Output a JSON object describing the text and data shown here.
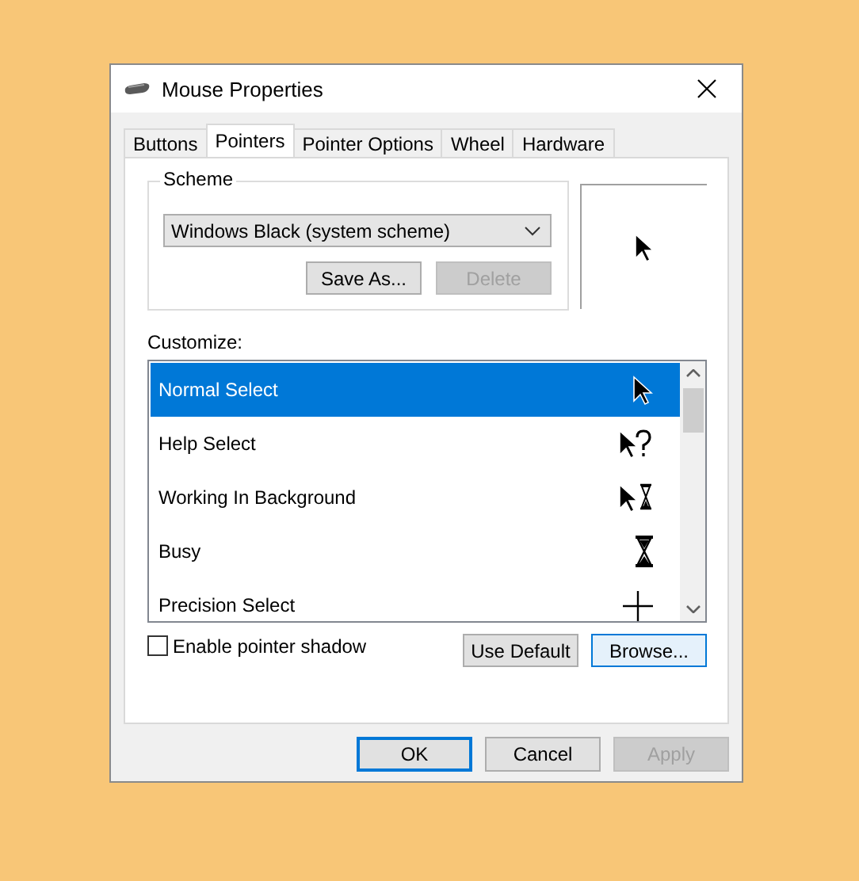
{
  "window": {
    "title": "Mouse Properties"
  },
  "tabs": [
    {
      "label": "Buttons",
      "selected": false
    },
    {
      "label": "Pointers",
      "selected": true
    },
    {
      "label": "Pointer Options",
      "selected": false
    },
    {
      "label": "Wheel",
      "selected": false
    },
    {
      "label": "Hardware",
      "selected": false
    }
  ],
  "scheme": {
    "label": "Scheme",
    "value": "Windows Black (system scheme)",
    "buttons": [
      {
        "label": "Save As...",
        "disabled": false,
        "focused": false
      },
      {
        "label": "Delete",
        "disabled": true,
        "focused": false
      }
    ]
  },
  "customize": {
    "label": "Customize:",
    "items": [
      {
        "name": "Normal Select",
        "kind": "arrow",
        "selected": true
      },
      {
        "name": "Help Select",
        "kind": "help",
        "selected": false
      },
      {
        "name": "Working In Background",
        "kind": "working",
        "selected": false
      },
      {
        "name": "Busy",
        "kind": "busy",
        "selected": false
      },
      {
        "name": "Precision Select",
        "kind": "precision",
        "selected": false
      }
    ]
  },
  "shadow": {
    "label": "Enable pointer shadow",
    "checked": false
  },
  "list_buttons": [
    {
      "label": "Use Default",
      "disabled": false,
      "focused": false
    },
    {
      "label": "Browse...",
      "disabled": false,
      "focused": true
    }
  ],
  "dialog_buttons": [
    {
      "label": "OK",
      "disabled": false,
      "focused": true
    },
    {
      "label": "Cancel",
      "disabled": false,
      "focused": false
    },
    {
      "label": "Apply",
      "disabled": true,
      "focused": false
    }
  ]
}
